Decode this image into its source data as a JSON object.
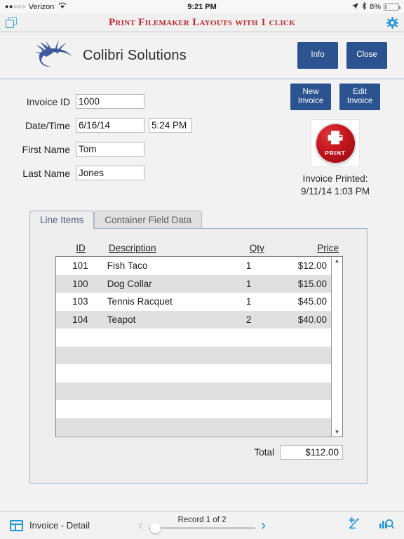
{
  "statusbar": {
    "signal_dots": "●●○○○",
    "carrier": "Verizon",
    "wifi_icon": "wifi-icon",
    "time": "9:21 PM",
    "location_icon": "location-arrow-icon",
    "bluetooth_icon": "bluetooth-icon",
    "battery_percent": "8%",
    "battery_icon": "battery-icon"
  },
  "appbar": {
    "stack_icon": "window-stack-icon",
    "banner_title": "Print Filemaker Layouts with 1 click",
    "gear_icon": "gear-icon",
    "banner_color": "#c0282d"
  },
  "header": {
    "logo_icon": "colibri-bird-logo",
    "brand": "Colibri Solutions",
    "info_label": "Info",
    "close_label": "Close",
    "button_color": "#2b538f"
  },
  "form": {
    "fields": [
      {
        "label": "Invoice ID",
        "value": "1000"
      },
      {
        "label": "Date/Time",
        "value": "6/16/14",
        "value2": "5:24 PM"
      },
      {
        "label": "First Name",
        "value": "Tom"
      },
      {
        "label": "Last Name",
        "value": "Jones"
      }
    ]
  },
  "actions": {
    "new_invoice_label": "New\nInvoice",
    "new_invoice_line1": "New",
    "new_invoice_line2": "Invoice",
    "edit_invoice_line1": "Edit",
    "edit_invoice_line2": "Invoice",
    "print_button_icon": "printer-icon",
    "print_button_label": "PRINT",
    "printed_label": "Invoice Printed:",
    "printed_value": "9/11/14 1:03 PM"
  },
  "tabs": [
    {
      "label": "Line Items",
      "active": true
    },
    {
      "label": "Container Field Data",
      "active": false
    }
  ],
  "table": {
    "columns": [
      "ID",
      "Description",
      "Qty",
      "Price"
    ],
    "rows": [
      {
        "id": "101",
        "description": "Fish Taco",
        "qty": "1",
        "price": "$12.00"
      },
      {
        "id": "100",
        "description": "Dog Collar",
        "qty": "1",
        "price": "$15.00"
      },
      {
        "id": "103",
        "description": "Tennis Racquet",
        "qty": "1",
        "price": "$45.00"
      },
      {
        "id": "104",
        "description": "Teapot",
        "qty": "2",
        "price": "$40.00"
      },
      {
        "id": "",
        "description": "",
        "qty": "",
        "price": ""
      },
      {
        "id": "",
        "description": "",
        "qty": "",
        "price": ""
      },
      {
        "id": "",
        "description": "",
        "qty": "",
        "price": ""
      },
      {
        "id": "",
        "description": "",
        "qty": "",
        "price": ""
      },
      {
        "id": "",
        "description": "",
        "qty": "",
        "price": ""
      },
      {
        "id": "",
        "description": "",
        "qty": "",
        "price": ""
      }
    ],
    "scroll_up_icon": "scroll-up-arrow-icon",
    "scroll_down_icon": "scroll-down-arrow-icon",
    "total_label": "Total",
    "total_value": "$112.00"
  },
  "toolbar": {
    "layout_icon": "layout-icon",
    "layout_name": "Invoice - Detail",
    "prev_icon": "chevron-left-icon",
    "next_icon": "chevron-right-icon",
    "prev_glyph": "‹",
    "next_glyph": "›",
    "record_label": "Record 1 of 2",
    "sort_icon": "sort-plus-minus-icon",
    "find_icon": "find-chart-icon"
  }
}
